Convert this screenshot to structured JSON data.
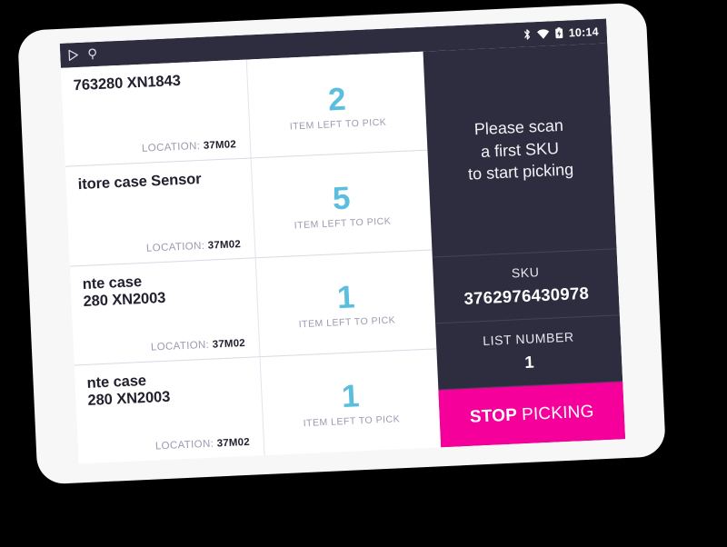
{
  "statusbar": {
    "left_icons": [
      "play-store-icon",
      "usb-android-icon"
    ],
    "right_icons": [
      "bluetooth-icon",
      "wifi-icon",
      "battery-charging-icon"
    ],
    "clock": "10:14"
  },
  "picklist": {
    "location_label": "LOCATION:",
    "qty_label": "ITEM LEFT TO PICK",
    "rows": [
      {
        "title": "763280 XN1843",
        "location": "37M02",
        "qty": "2"
      },
      {
        "title": "itore case Sensor",
        "location": "37M02",
        "qty": "5"
      },
      {
        "title": "nte case\n280 XN2003",
        "location": "37M02",
        "qty": "1"
      },
      {
        "title": "nte case\n280 XN2003",
        "location": "37M02",
        "qty": "1"
      }
    ]
  },
  "sidepanel": {
    "scan_message": "Please scan\na first SKU\nto start picking",
    "sku_label": "SKU",
    "sku_value": "3762976430978",
    "list_number_label": "LIST NUMBER",
    "list_number_value": "1",
    "stop_button": {
      "strong": "STOP",
      "light": "PICKING"
    }
  },
  "colors": {
    "panel_dark": "#2d2d3f",
    "accent_cyan": "#5bbedc",
    "accent_pink": "#f5009b",
    "bezel": "#f7f7f7",
    "background": "#000000",
    "muted_text": "#9a9bae"
  }
}
